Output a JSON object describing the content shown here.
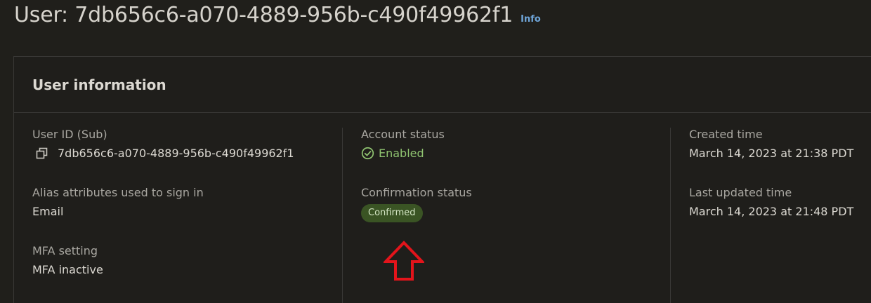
{
  "header": {
    "title": "User: 7db656c6-a070-4889-956b-c490f49962f1",
    "info_link": "Info"
  },
  "user_information": {
    "title": "User information",
    "user_id": {
      "label": "User ID (Sub)",
      "value": "7db656c6-a070-4889-956b-c490f49962f1",
      "icon": "copy-icon"
    },
    "alias_attributes": {
      "label": "Alias attributes used to sign in",
      "value": "Email"
    },
    "mfa_setting": {
      "label": "MFA setting",
      "value": "MFA inactive"
    },
    "account_status": {
      "label": "Account status",
      "value": "Enabled",
      "icon": "check-circle-icon",
      "color": "#8fc370"
    },
    "confirmation_status": {
      "label": "Confirmation status",
      "value": "Confirmed",
      "badge_color": "#3a5424"
    },
    "created_time": {
      "label": "Created time",
      "value": "March 14, 2023 at 21:38 PDT"
    },
    "last_updated_time": {
      "label": "Last updated time",
      "value": "March 14, 2023 at 21:48 PDT"
    }
  },
  "annotation": {
    "icon": "up-arrow-icon",
    "color": "#e3141b"
  }
}
